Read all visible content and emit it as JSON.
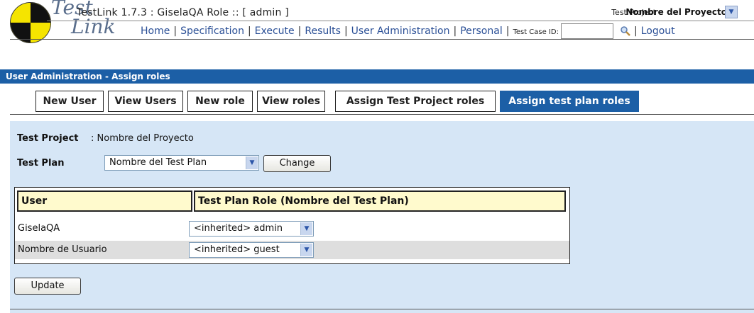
{
  "header": {
    "logo_test": "Test",
    "logo_link": "Link",
    "title": "TestLink 1.7.3 : GiselaQA Role :: [ admin ]",
    "project_label": "Test Project",
    "project_name": "Nombre del Proyecto"
  },
  "nav": {
    "items": [
      "Home",
      "Specification",
      "Execute",
      "Results",
      "User Administration",
      "Personal"
    ],
    "tcid_label": "Test Case ID:",
    "logout": "Logout"
  },
  "section_bar": "User Administration - Assign roles",
  "tabs": [
    {
      "label": "New User"
    },
    {
      "label": "View Users"
    },
    {
      "label": "New role"
    },
    {
      "label": "View roles"
    },
    {
      "label": "Assign Test Project roles"
    },
    {
      "label": "Assign test plan roles"
    }
  ],
  "form": {
    "project_label": "Test Project",
    "project_value": ": Nombre del Proyecto",
    "plan_label": "Test Plan",
    "plan_value": "Nombre del Test Plan",
    "change_button": "Change",
    "update_button": "Update"
  },
  "table": {
    "headers": [
      "User",
      "Test Plan Role (Nombre del Test Plan)"
    ],
    "rows": [
      {
        "user": "GiselaQA",
        "role": "<inherited> admin"
      },
      {
        "user": "Nombre de Usuario",
        "role": "<inherited> guest"
      }
    ]
  },
  "colors": {
    "header_bar": "#1c5fa6",
    "main_bg": "#d6e6f6",
    "table_header_bg": "#fffacd",
    "row_alt_bg": "#dedede",
    "link": "#2a4f96"
  },
  "active_tab": "Assign test plan roles"
}
